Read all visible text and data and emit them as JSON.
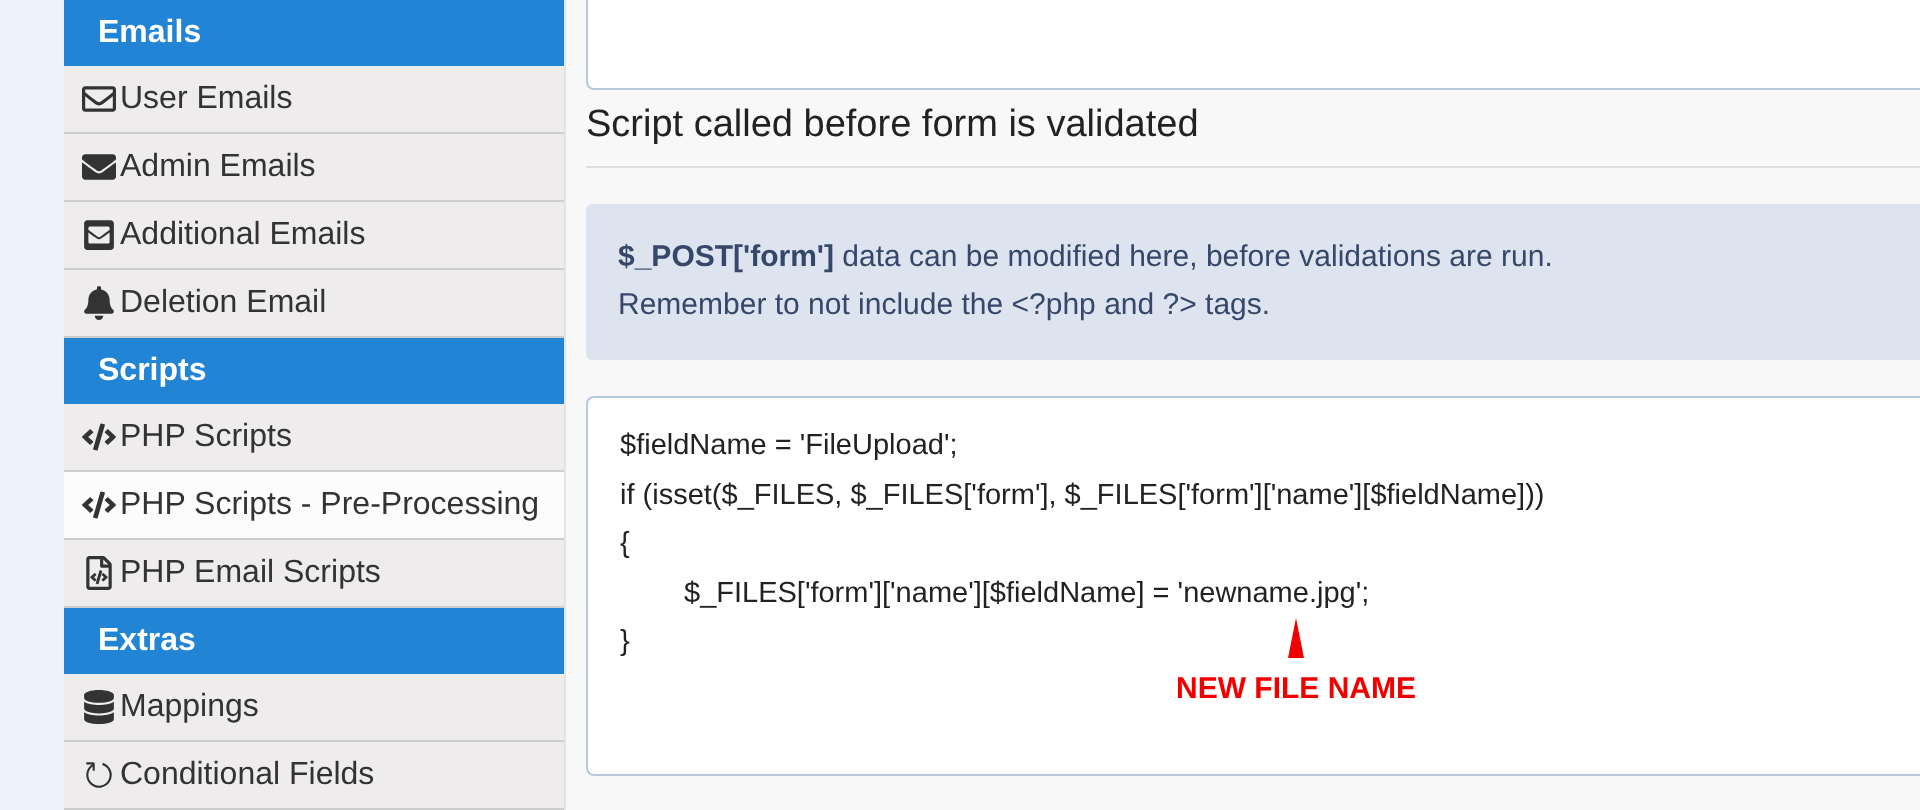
{
  "sidebar": {
    "sections": [
      {
        "title": "Emails",
        "items": [
          {
            "label": "User Emails",
            "selected": false
          },
          {
            "label": "Admin Emails",
            "selected": false
          },
          {
            "label": "Additional Emails",
            "selected": false
          },
          {
            "label": "Deletion Email",
            "selected": false
          }
        ]
      },
      {
        "title": "Scripts",
        "items": [
          {
            "label": "PHP Scripts",
            "selected": false
          },
          {
            "label": "PHP Scripts - Pre-Processing",
            "selected": true
          },
          {
            "label": "PHP Email Scripts",
            "selected": false
          }
        ]
      },
      {
        "title": "Extras",
        "items": [
          {
            "label": "Mappings",
            "selected": false
          },
          {
            "label": "Conditional Fields",
            "selected": false
          }
        ]
      }
    ]
  },
  "main": {
    "heading": "Script called before form is validated",
    "info": [
      "**$_POST['form']** data can be modified here, before validations are run.",
      "Remember to not include the <?php and ?> tags."
    ],
    "code_lines": [
      {
        "text": "$fieldName = 'FileUpload';",
        "indent": false
      },
      {
        "text": "if (isset($_FILES, $_FILES['form'], $_FILES['form']['name'][$fieldName]))",
        "indent": false
      },
      {
        "text": "{",
        "indent": false
      },
      {
        "text": "$_FILES['form']['name'][$fieldName] = 'newname.jpg';",
        "indent": true
      },
      {
        "text": "}",
        "indent": false
      }
    ],
    "annotation": "NEW FILE NAME"
  }
}
